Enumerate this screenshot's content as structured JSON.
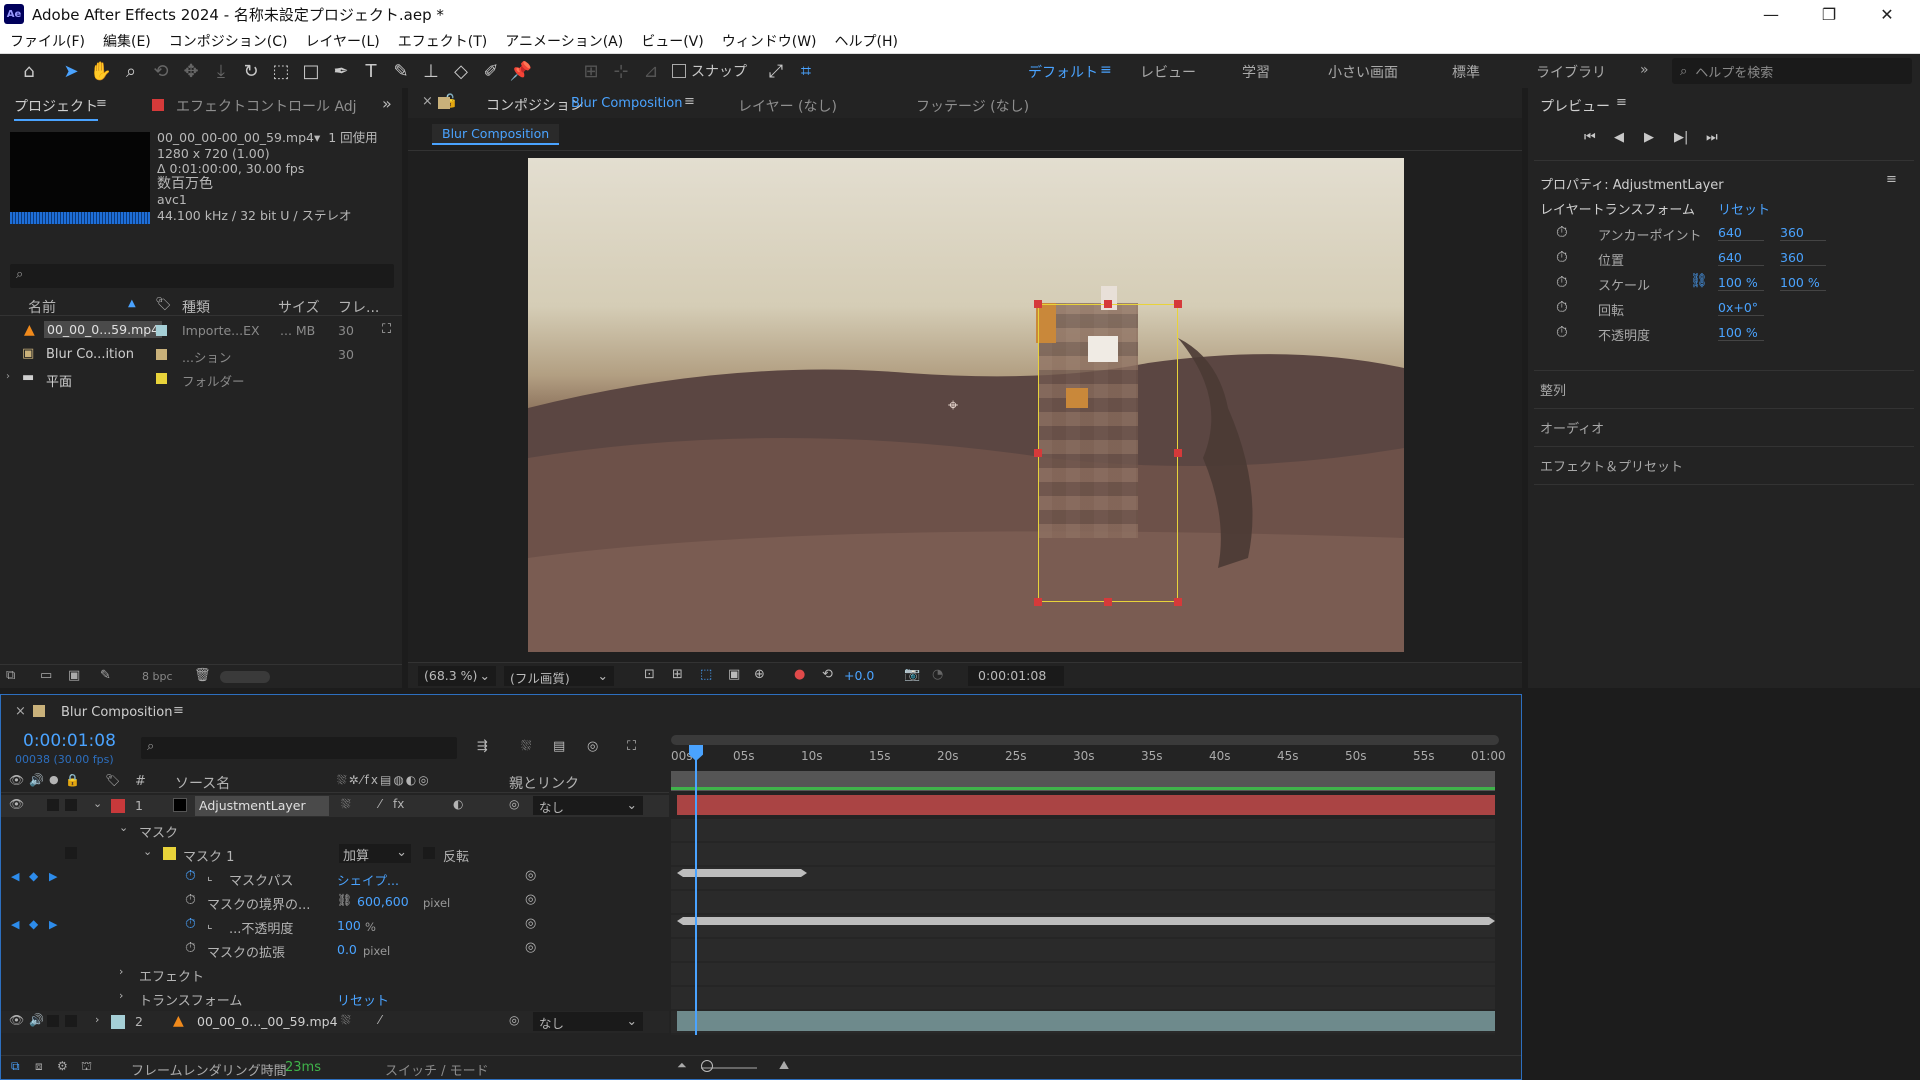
{
  "app": {
    "title": "Adobe After Effects 2024 - 名称未設定プロジェクト.aep *",
    "logo": "Ae"
  },
  "window_controls": {
    "minimize": "—",
    "maximize": "❐",
    "close": "✕"
  },
  "menu": [
    "ファイル(F)",
    "編集(E)",
    "コンポジション(C)",
    "レイヤー(L)",
    "エフェクト(T)",
    "アニメーション(A)",
    "ビュー(V)",
    "ウィンドウ(W)",
    "ヘルプ(H)"
  ],
  "toolbar": {
    "snap_label": "スナップ",
    "workspaces": [
      "デフォルト",
      "レビュー",
      "学習",
      "小さい画面",
      "標準",
      "ライブラリ"
    ],
    "help_placeholder": "ヘルプを検索"
  },
  "project_panel": {
    "tab_project": "プロジェクト",
    "tab_effects": "エフェクトコントロール Adjustm",
    "footage_info": {
      "name": "00_00_00-00_00_59.mp4▾",
      "usage": "1 回使用",
      "dims": "1280 x 720 (1.00)",
      "duration": "Δ 0:01:00:00, 30.00 fps",
      "colors": "数百万色",
      "codec": "avc1",
      "audio": "44.100 kHz / 32 bit U / ステレオ"
    },
    "search_placeholder": "",
    "columns": [
      "名前",
      "種類",
      "サイズ",
      "フレ..."
    ],
    "items": [
      {
        "name": "00_00_0...59.mp4",
        "type": "Importe...EX",
        "size": "... MB",
        "fps": "30",
        "color": "#a5cfd6",
        "icon": "footage-icon"
      },
      {
        "name": "Blur Co...ition",
        "type": "...ション",
        "size": "",
        "fps": "30",
        "color": "#c9b17a",
        "icon": "composition-icon"
      },
      {
        "name": "平面",
        "type": "フォルダー",
        "size": "",
        "fps": "",
        "color": "#e8d33a",
        "icon": "folder-icon"
      }
    ],
    "bpc": "8 bpc"
  },
  "composition_panel": {
    "tab_label": "コンポジション",
    "tab_comp_name": "Blur Composition",
    "tab_layer": "レイヤー (なし)",
    "tab_footage": "フッテージ (なし)",
    "breadcrumb": "Blur Composition",
    "zoom": "(68.3 %)",
    "quality": "(フル画質)",
    "exposure": "+0.0",
    "timecode": "0:00:01:08"
  },
  "right_panel": {
    "preview_title": "プレビュー",
    "properties_title": "プロパティ: AdjustmentLayer",
    "layer_transform": "レイヤートランスフォーム",
    "reset": "リセット",
    "props": [
      {
        "label": "アンカーポイント",
        "v1": "640",
        "v2": "360"
      },
      {
        "label": "位置",
        "v1": "640",
        "v2": "360"
      },
      {
        "label": "スケール",
        "v1": "100 %",
        "v2": "100 %"
      },
      {
        "label": "回転",
        "v1": "0x+0°",
        "v2": ""
      },
      {
        "label": "不透明度",
        "v1": "100 %",
        "v2": ""
      }
    ],
    "sections": [
      "整列",
      "オーディオ",
      "エフェクト＆プリセット"
    ]
  },
  "timeline": {
    "tab_name": "Blur Composition",
    "timecode": "0:00:01:08",
    "frame_info": "00038 (30.00 fps)",
    "header_source": "ソース名",
    "header_parent": "親とリンク",
    "header_num": "#",
    "ruler": [
      "00s",
      "05s",
      "10s",
      "15s",
      "20s",
      "25s",
      "30s",
      "35s",
      "40s",
      "45s",
      "50s",
      "55s",
      "01:00"
    ],
    "layer1": {
      "num": "1",
      "name": "AdjustmentLayer",
      "parent": "なし"
    },
    "layer2": {
      "num": "2",
      "name": "00_00_0..._00_59.mp4",
      "parent": "なし"
    },
    "mask_group": "マスク",
    "mask1": "マスク 1",
    "mask_mode": "加算",
    "mask_invert": "反転",
    "mask_path": "マスクパス",
    "mask_path_val": "シェイプ...",
    "mask_feather": "マスクの境界の...",
    "mask_feather_val": "600,600",
    "mask_feather_unit": "pixel",
    "mask_opacity": "...不透明度",
    "mask_opacity_val": "100",
    "mask_opacity_unit": "%",
    "mask_expansion": "マスクの拡張",
    "mask_expansion_val": "0.0",
    "mask_expansion_unit": "pixel",
    "effect_group": "エフェクト",
    "transform_group": "トランスフォーム",
    "transform_reset": "リセット",
    "footer_render": "フレームレンダリング時間",
    "footer_render_val": "23ms",
    "footer_switch": "スイッチ / モード"
  }
}
